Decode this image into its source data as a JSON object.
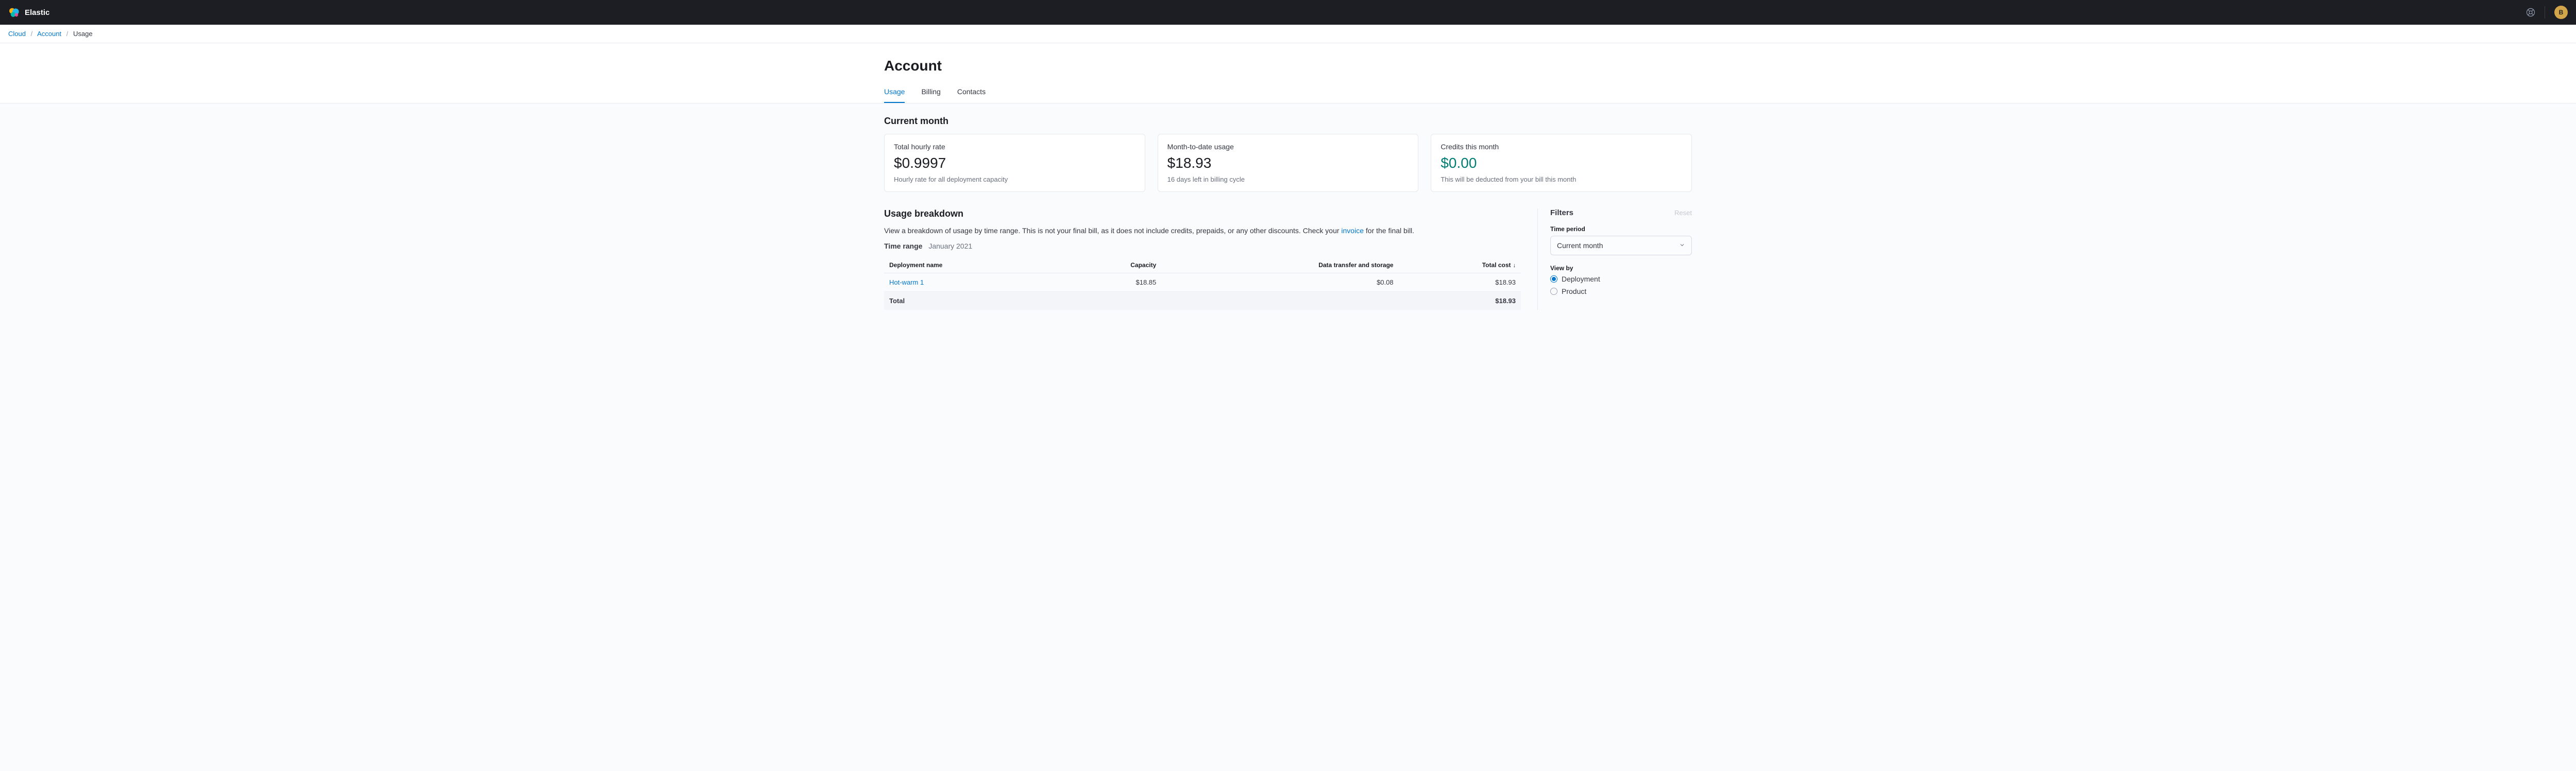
{
  "header": {
    "brand": "Elastic",
    "avatar_initial": "B"
  },
  "breadcrumb": {
    "items": [
      "Cloud",
      "Account"
    ],
    "current": "Usage"
  },
  "page_title": "Account",
  "tabs": [
    {
      "label": "Usage",
      "active": true
    },
    {
      "label": "Billing",
      "active": false
    },
    {
      "label": "Contacts",
      "active": false
    }
  ],
  "current_month": {
    "title": "Current month",
    "cards": [
      {
        "label": "Total hourly rate",
        "value": "$0.9997",
        "sub": "Hourly rate for all deployment capacity",
        "variant": "default"
      },
      {
        "label": "Month-to-date usage",
        "value": "$18.93",
        "sub": "16 days left in billing cycle",
        "variant": "default"
      },
      {
        "label": "Credits this month",
        "value": "$0.00",
        "sub": "This will be deducted from your bill this month",
        "variant": "credits"
      }
    ]
  },
  "breakdown": {
    "title": "Usage breakdown",
    "desc_before": "View a breakdown of usage by time range. This is not your final bill, as it does not include credits, prepaids, or any other discounts. Check your ",
    "desc_link": "invoice",
    "desc_after": " for the final bill.",
    "time_range_label": "Time range",
    "time_range_value": "January 2021",
    "columns": [
      "Deployment name",
      "Capacity",
      "Data transfer and storage",
      "Total cost"
    ],
    "rows": [
      {
        "name": "Hot-warm 1",
        "capacity": "$18.85",
        "dts": "$0.08",
        "total": "$18.93"
      }
    ],
    "total_label": "Total",
    "grand_total": "$18.93"
  },
  "filters": {
    "title": "Filters",
    "reset": "Reset",
    "time_period_label": "Time period",
    "time_period_value": "Current month",
    "view_by_label": "View by",
    "view_by_options": [
      {
        "label": "Deployment",
        "checked": true
      },
      {
        "label": "Product",
        "checked": false
      }
    ]
  }
}
